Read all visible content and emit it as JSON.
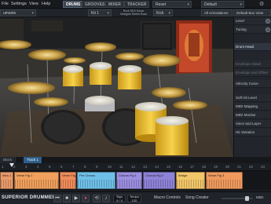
{
  "menu": {
    "items": [
      "File",
      "Settings",
      "View",
      "Help"
    ]
  },
  "nav_tabs": [
    "DRUMS",
    "GROOVES",
    "MIXER",
    "TRACKER"
  ],
  "header": {
    "preset_dropdown": "Reset",
    "preset_default": "Default"
  },
  "subbar": {
    "left_dropdown": "umsets",
    "kit_dropdown": "Kit 1",
    "kit_title_line1": "Rock SDX Sonar",
    "kit_title_line2": "Designer Series Rock",
    "mode_dropdown": "Kick",
    "articulation_dropdown": "All Articulations",
    "default_view": "Default Box View"
  },
  "right_panel": {
    "rows": [
      {
        "label": "Level",
        "style": "normal",
        "knob": true
      },
      {
        "label": "Tuning",
        "style": "normal",
        "knob": true
      },
      {
        "label": "Drum Head",
        "style": "hl",
        "knob": false
      },
      {
        "label": "",
        "style": "dim",
        "knob": false
      },
      {
        "label": "Envelope Attack",
        "style": "dim",
        "knob": false
      },
      {
        "label": "Envelope and Offset",
        "style": "dim",
        "knob": false
      },
      {
        "label": "Velocity Curve",
        "style": "normal",
        "knob": false
      },
      {
        "label": "Soft Hit Level",
        "style": "normal",
        "knob": false
      },
      {
        "label": "MIDI Mapping",
        "style": "normal",
        "knob": false
      },
      {
        "label": "MIDI Monitor",
        "style": "normal",
        "knob": false
      },
      {
        "label": "Voice and Layer",
        "style": "normal",
        "knob": false
      },
      {
        "label": "Hit Variation",
        "style": "normal",
        "knob": false
      }
    ]
  },
  "song_tabs": [
    "Block",
    "Track 1"
  ],
  "ruler": [
    "1",
    "2",
    "3",
    "4",
    "5",
    "6",
    "7",
    "8",
    "9",
    "10",
    "11",
    "12",
    "13",
    "14",
    "15",
    "16",
    "17",
    "18",
    "19",
    "20",
    "21",
    "22",
    "23"
  ],
  "track_blocks": [
    {
      "label": "Intro 1",
      "color": "#e89a6a"
    },
    {
      "label": "Verse Fig 1",
      "color": "#f0a05c"
    },
    {
      "label": "Verse Fig 2",
      "color": "#f08c5a"
    },
    {
      "label": "Pre Chorus",
      "color": "#6fc0e8"
    },
    {
      "label": "Chorus Fig 1",
      "color": "#9c8ee0"
    },
    {
      "label": "Chorus Fig 2",
      "color": "#8e82d8"
    },
    {
      "label": "Bridge",
      "color": "#f2c76a"
    },
    {
      "label": "Verse Fig 3",
      "color": "#f09a5e"
    }
  ],
  "transport": {
    "logo": "SUPERIOR DRUMMER 3",
    "sign_label": "Sign",
    "sign_value": "4 / 4",
    "tempo_label": "Tempo",
    "tempo_value": "120",
    "macro_label": "Macro Controls",
    "song_creator_label": "Song Creator",
    "midi_label": "MIDI"
  },
  "colors": {
    "accent": "#2e5f8c",
    "drum_shell": "#f2c22e",
    "cymbal": "#c9a24a"
  }
}
